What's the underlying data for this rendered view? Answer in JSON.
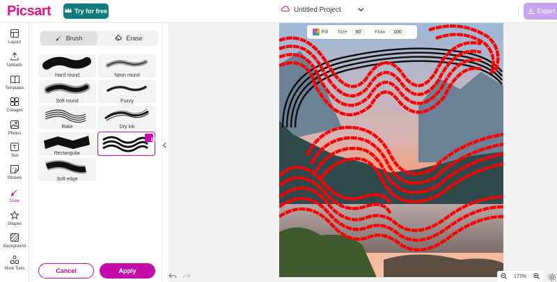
{
  "app": {
    "logo": "Picsart",
    "try_label": "Try for free",
    "project_title": "Untitled Project",
    "export_label": "Export"
  },
  "rail": [
    {
      "label": "Layout",
      "icon": "layout-icon"
    },
    {
      "label": "Uploads",
      "icon": "upload-icon"
    },
    {
      "label": "Templates",
      "icon": "templates-icon"
    },
    {
      "label": "Collages",
      "icon": "collage-icon"
    },
    {
      "label": "Photos",
      "icon": "photo-icon"
    },
    {
      "label": "Text",
      "icon": "text-icon"
    },
    {
      "label": "Stickers",
      "icon": "sticker-icon"
    },
    {
      "label": "Draw",
      "icon": "brush-icon",
      "active": true
    },
    {
      "label": "Shapes",
      "icon": "star-icon"
    },
    {
      "label": "Background",
      "icon": "background-icon"
    },
    {
      "label": "More Tools",
      "icon": "more-tools-icon"
    }
  ],
  "panel": {
    "tabs": [
      "Brush",
      "Erase"
    ],
    "brushes": [
      "Hard round",
      "Neon round",
      "Soft round",
      "Fuzzy",
      "Rake",
      "Dry ink",
      "Rectangular",
      "",
      "Soft edge"
    ],
    "cancel_label": "Cancel",
    "apply_label": "Apply"
  },
  "toolbar": {
    "fill_label": "Fill",
    "size_label": "Size",
    "size_value": "80",
    "flow_label": "Flow",
    "flow_value": "100"
  },
  "zoom": {
    "level": "177%"
  },
  "colors": {
    "brand": "#e6147c",
    "accent": "#c20ba8",
    "teal": "#0f7b7c",
    "export": "#c6a6f2",
    "paint": "#ff0000"
  }
}
